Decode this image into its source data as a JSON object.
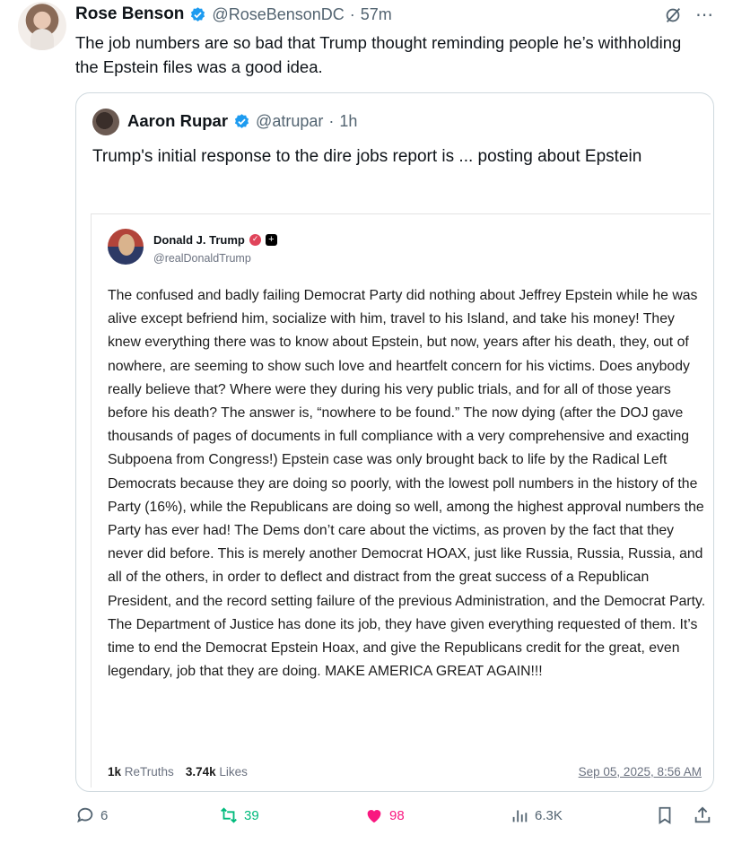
{
  "tweet": {
    "author_name": "Rose Benson",
    "author_handle": "@RoseBensonDC",
    "separator": "·",
    "time": "57m",
    "text": "The job numbers are so bad that Trump thought reminding people he’s withholding the Epstein files was a good idea."
  },
  "quote": {
    "author_name": "Aaron Rupar",
    "author_handle": "@atrupar",
    "separator": "·",
    "time": "1h",
    "text": "Trump's initial response to the dire jobs report is ... posting about Epstein"
  },
  "truth": {
    "author_name": "Donald J. Trump",
    "author_handle": "@realDonaldTrump",
    "badge_plus": "+",
    "text": "The confused and badly failing Democrat Party did nothing about Jeffrey Epstein while he was alive except befriend him, socialize with him, travel to his Island, and take his money! They knew everything there was to know about Epstein, but now, years after his death, they, out of nowhere, are seeming to show such love and heartfelt concern for his victims. Does anybody really believe that? Where were they during his very public trials, and for all of those years before his death? The answer is, “nowhere to be found.” The now dying (after the DOJ gave thousands of pages of documents in full compliance with a very comprehensive and exacting Subpoena from Congress!) Epstein case was only brought back to life by the Radical Left Democrats because they are doing so poorly, with the lowest poll numbers in the history of the Party (16%), while the Republicans are doing so well, among the highest approval numbers the Party has ever had! The Dems don’t care about the victims, as proven by the fact that they never did before. This is merely another Democrat HOAX, just like Russia, Russia, Russia, and all of the others, in order to deflect and distract from the great success of a Republican President, and the record setting failure of the previous Administration, and the Democrat Party. The Department of Justice has done its job, they have given everything requested of them. It’s time to end the Democrat Epstein Hoax, and give the Republicans credit for the great, even legendary, job that they are doing. MAKE AMERICA GREAT AGAIN!!!",
    "retruths_count": "1k",
    "retruths_label": "ReTruths",
    "likes_count": "3.74k",
    "likes_label": "Likes",
    "date": "Sep 05, 2025, 8:56 AM"
  },
  "actions": {
    "replies": "6",
    "reposts": "39",
    "likes": "98",
    "views": "6.3K"
  },
  "colors": {
    "verified": "#1d9bf0",
    "repost": "#00ba7c",
    "like": "#f91880",
    "muted": "#536471"
  },
  "icons": [
    "verified-badge-icon",
    "grok-slash-icon",
    "more-icon",
    "reply-icon",
    "repost-icon",
    "heart-icon",
    "views-icon",
    "bookmark-icon",
    "share-icon"
  ]
}
